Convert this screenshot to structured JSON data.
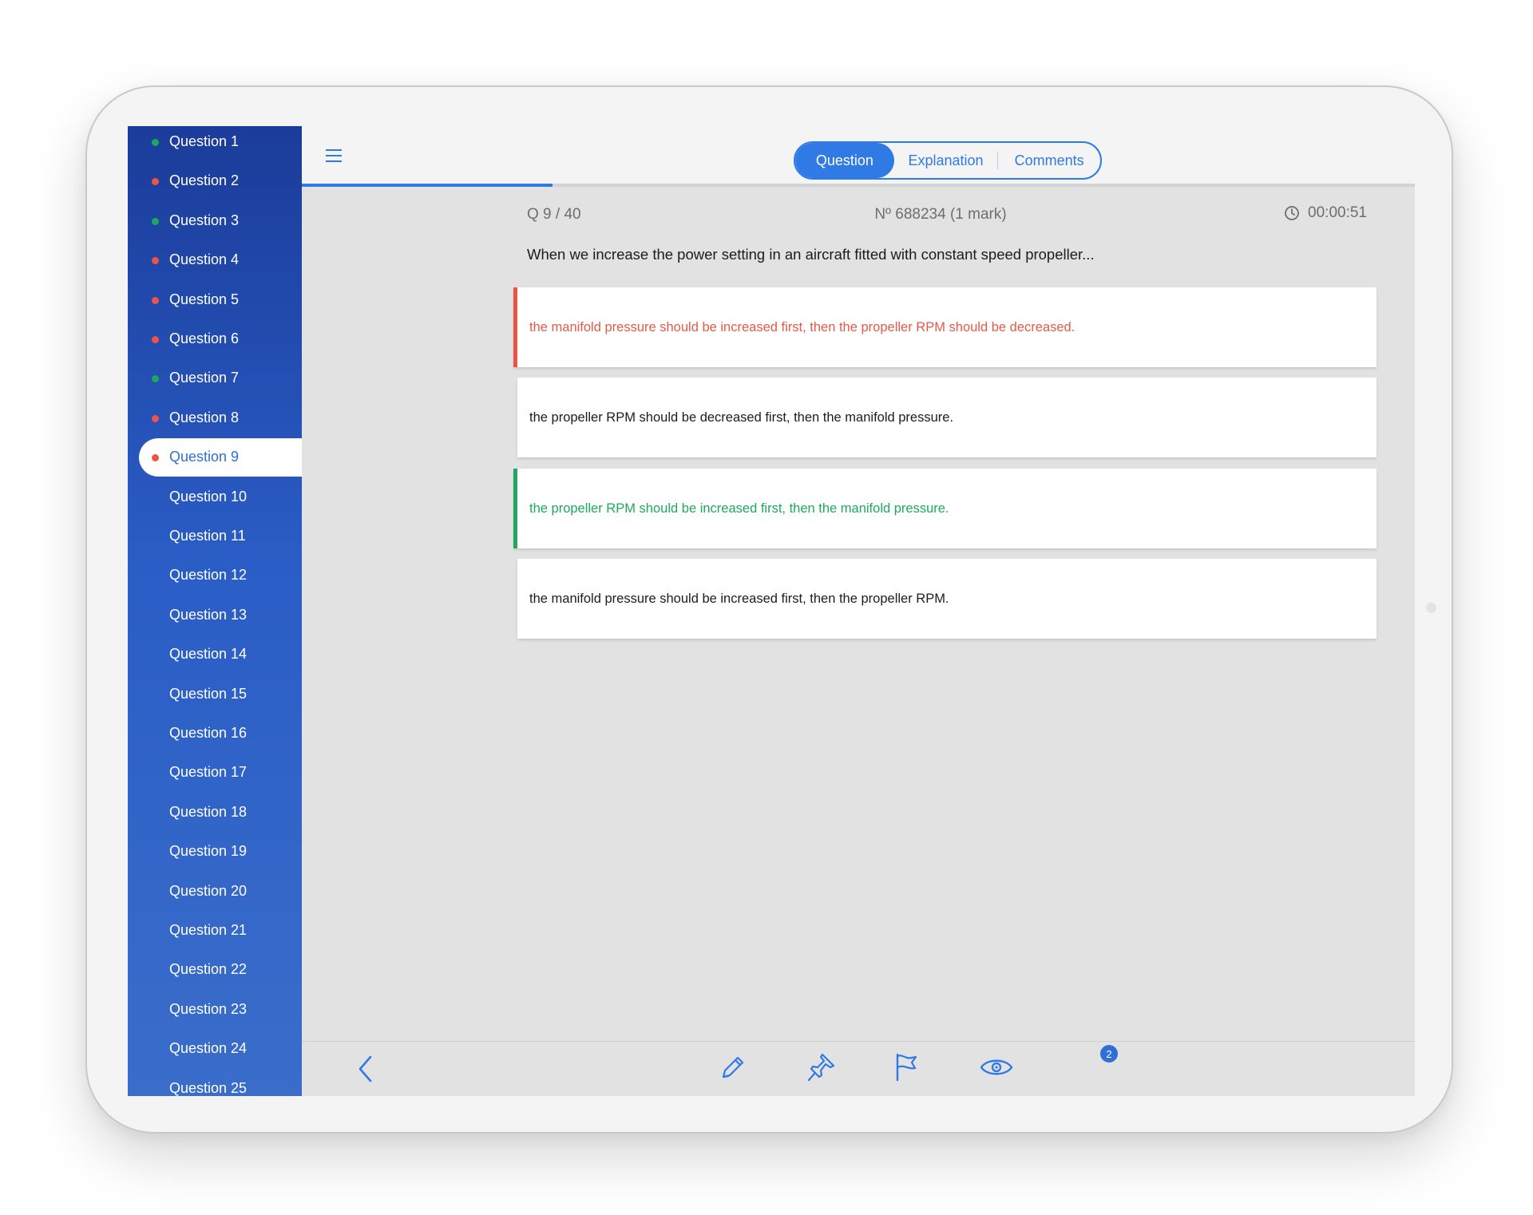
{
  "sidebar": {
    "items": [
      {
        "label": "Question 1",
        "status": "correct"
      },
      {
        "label": "Question 2",
        "status": "wrong"
      },
      {
        "label": "Question 3",
        "status": "correct"
      },
      {
        "label": "Question 4",
        "status": "wrong"
      },
      {
        "label": "Question 5",
        "status": "wrong"
      },
      {
        "label": "Question 6",
        "status": "wrong"
      },
      {
        "label": "Question 7",
        "status": "correct"
      },
      {
        "label": "Question 8",
        "status": "wrong"
      },
      {
        "label": "Question 9",
        "status": "wrong",
        "active": true
      },
      {
        "label": "Question 10",
        "status": "none"
      },
      {
        "label": "Question 11",
        "status": "none"
      },
      {
        "label": "Question 12",
        "status": "none"
      },
      {
        "label": "Question 13",
        "status": "none"
      },
      {
        "label": "Question 14",
        "status": "none"
      },
      {
        "label": "Question 15",
        "status": "none"
      },
      {
        "label": "Question 16",
        "status": "none"
      },
      {
        "label": "Question 17",
        "status": "none"
      },
      {
        "label": "Question 18",
        "status": "none"
      },
      {
        "label": "Question 19",
        "status": "none"
      },
      {
        "label": "Question 20",
        "status": "none"
      },
      {
        "label": "Question 21",
        "status": "none"
      },
      {
        "label": "Question 22",
        "status": "none"
      },
      {
        "label": "Question 23",
        "status": "none"
      },
      {
        "label": "Question 24",
        "status": "none"
      },
      {
        "label": "Question 25",
        "status": "none"
      }
    ]
  },
  "tabs": {
    "question": "Question",
    "explanation": "Explanation",
    "comments": "Comments",
    "active": "question"
  },
  "progress": 0.225,
  "header": {
    "counter": "Q  9 / 40",
    "number": "Nº 688234 (1 mark)",
    "timer": "00:00:51"
  },
  "question": {
    "text": "When we increase the power setting in an aircraft fitted with constant speed propeller...",
    "answers": [
      {
        "text": "the manifold pressure should be increased first, then the propeller RPM should be decreased.",
        "state": "wrong"
      },
      {
        "text": "the propeller RPM should be decreased first, then the manifold pressure.",
        "state": "neutral"
      },
      {
        "text": "the propeller RPM should be increased first, then the manifold pressure.",
        "state": "correct"
      },
      {
        "text": "the manifold pressure should be increased first, then the propeller RPM.",
        "state": "neutral"
      }
    ]
  },
  "toolbar": {
    "icons": [
      "back-chevron-icon",
      "pencil-icon",
      "pin-icon",
      "flag-icon",
      "eye-icon"
    ],
    "eye_badge": "2"
  },
  "colors": {
    "accent": "#2f7ae5",
    "correct": "#20a862",
    "wrong": "#ea5546",
    "sidebar_top": "#1b3c9a",
    "sidebar_bottom": "#3a6dca"
  }
}
